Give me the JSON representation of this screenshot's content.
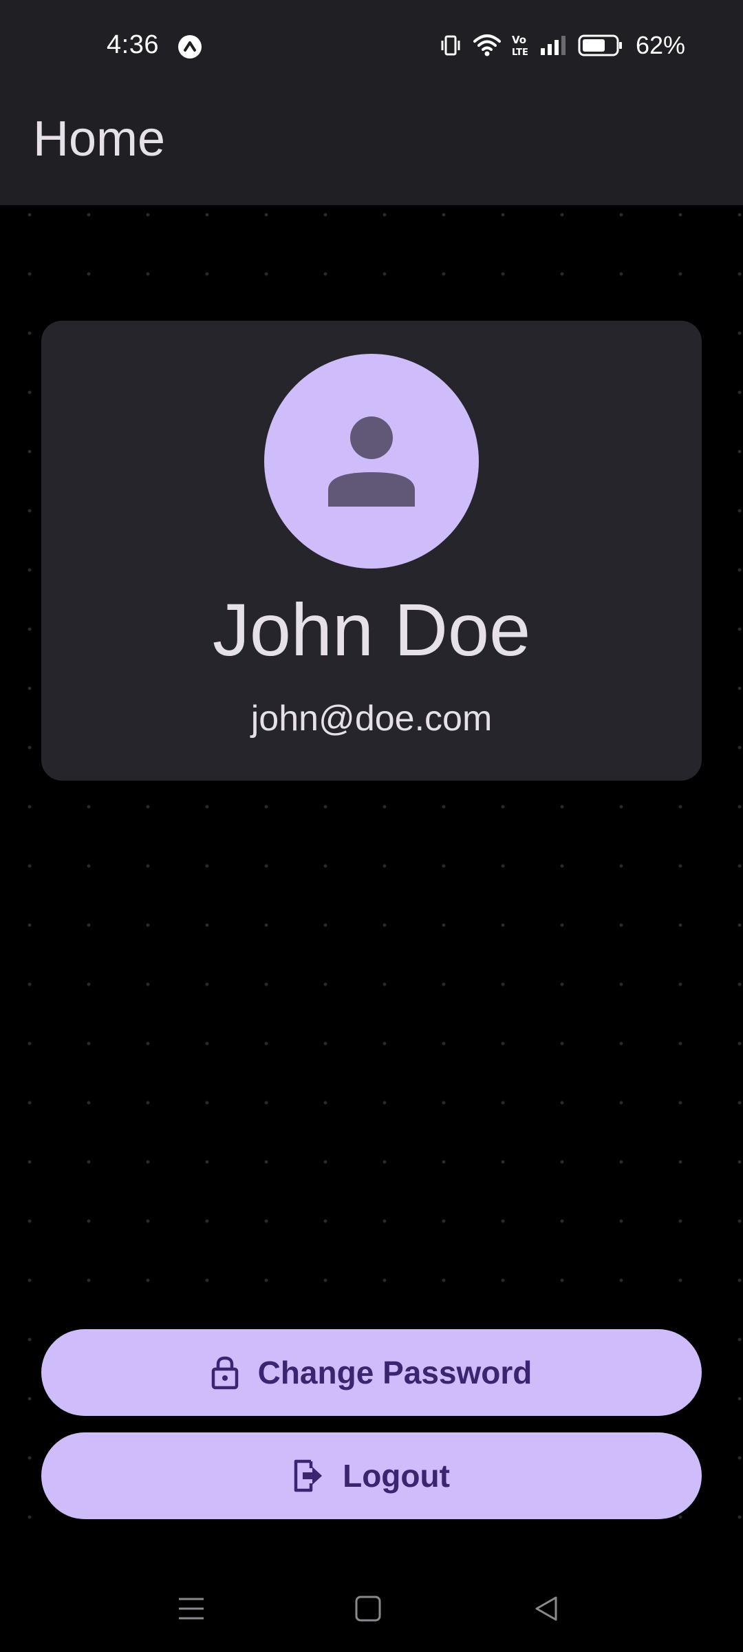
{
  "status_bar": {
    "time": "4:36",
    "battery_percent": "62%",
    "icons": [
      "app-notification-icon",
      "vibrate-icon",
      "wifi-icon",
      "volte-icon",
      "signal-icon",
      "battery-icon"
    ]
  },
  "app_bar": {
    "title": "Home"
  },
  "profile": {
    "name": "John Doe",
    "email": "john@doe.com",
    "avatar_icon": "person-icon"
  },
  "actions": {
    "change_password_label": "Change Password",
    "change_password_icon": "lock-icon",
    "logout_label": "Logout",
    "logout_icon": "logout-icon"
  },
  "nav_bar": {
    "icons": [
      "menu-icon",
      "home-icon",
      "back-icon"
    ]
  },
  "colors": {
    "background": "#000000",
    "bar": "#1f1f24",
    "card": "#26252b",
    "accent": "#cfbcfa",
    "on_accent": "#3b2470",
    "text": "#e6e1e9"
  }
}
